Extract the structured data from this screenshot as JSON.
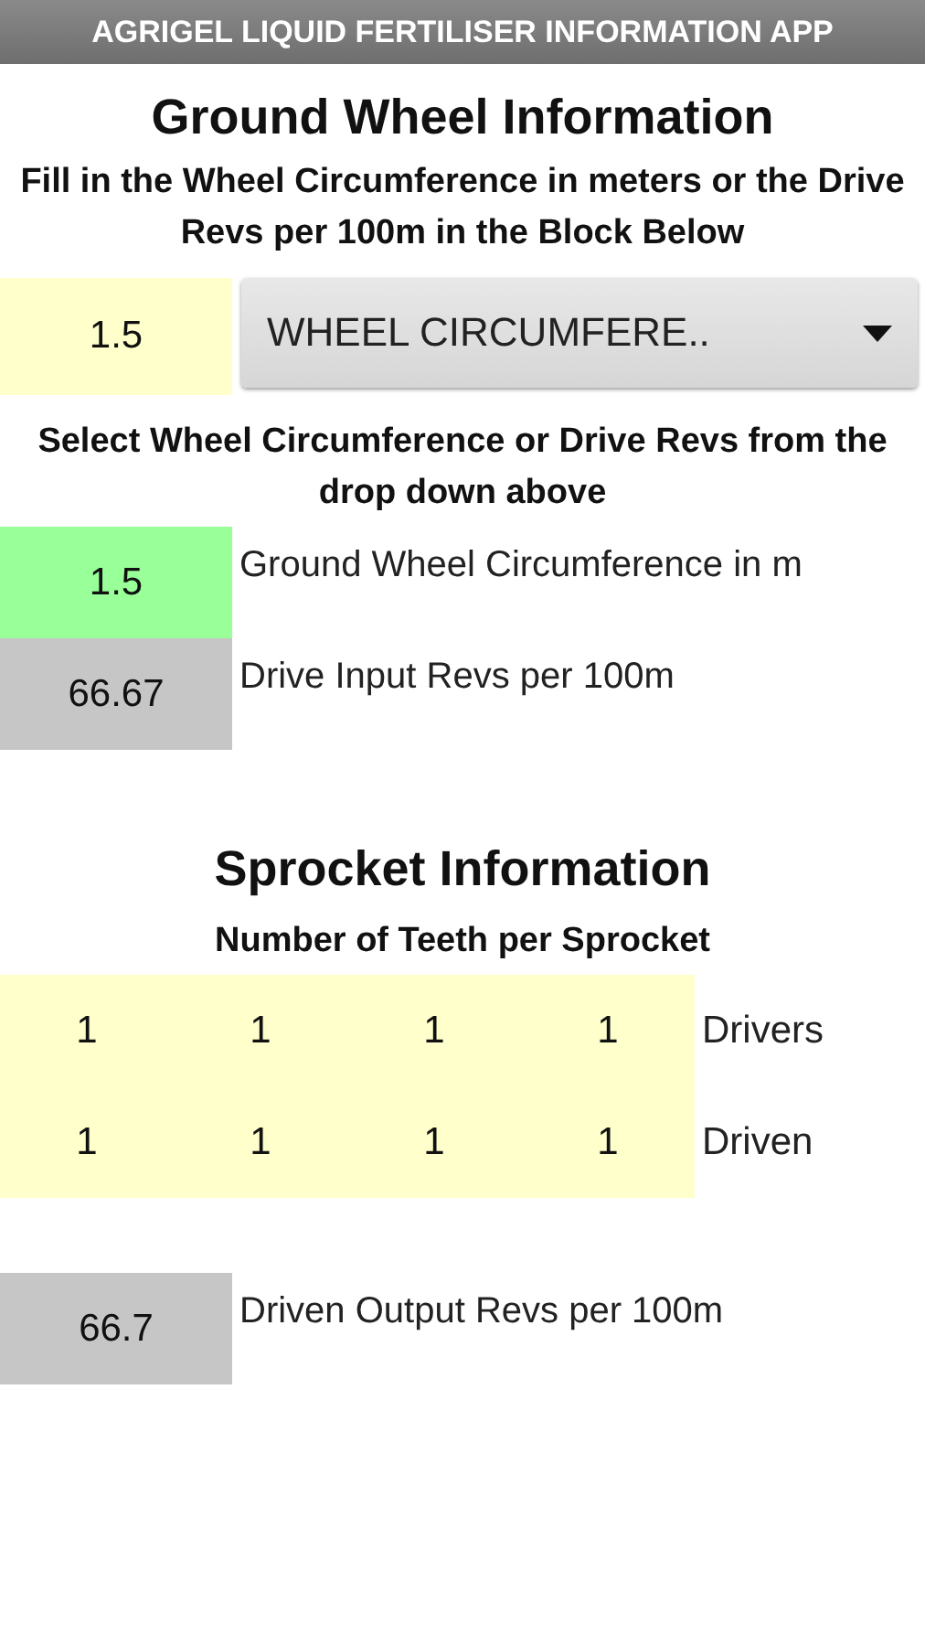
{
  "app_bar": {
    "title": "AGRIGEL LIQUID FERTILISER INFORMATION APP"
  },
  "ground_wheel": {
    "heading": "Ground Wheel Information",
    "instructions": "Fill in the Wheel Circumference in meters or the Drive Revs per 100m in the Block Below",
    "input": {
      "value": "1.5"
    },
    "dropdown": {
      "value": "WHEEL CIRCUMFERE.."
    },
    "hint": "Select Wheel Circumference or Drive Revs from the drop down above",
    "results": [
      {
        "value": "1.5",
        "label": "Ground Wheel Circumference in m",
        "highlighted": true
      },
      {
        "value": "66.67",
        "label": "Drive Input Revs per 100m",
        "highlighted": false
      }
    ]
  },
  "sprocket": {
    "heading": "Sprocket Information",
    "subheading": "Number of Teeth per Sprocket",
    "rows": [
      {
        "label": "Drivers",
        "teeth": [
          "1",
          "1",
          "1",
          "1"
        ]
      },
      {
        "label": "Driven",
        "teeth": [
          "1",
          "1",
          "1",
          "1"
        ]
      }
    ],
    "output": {
      "value": "66.7",
      "label": "Driven Output Revs per 100m"
    }
  }
}
